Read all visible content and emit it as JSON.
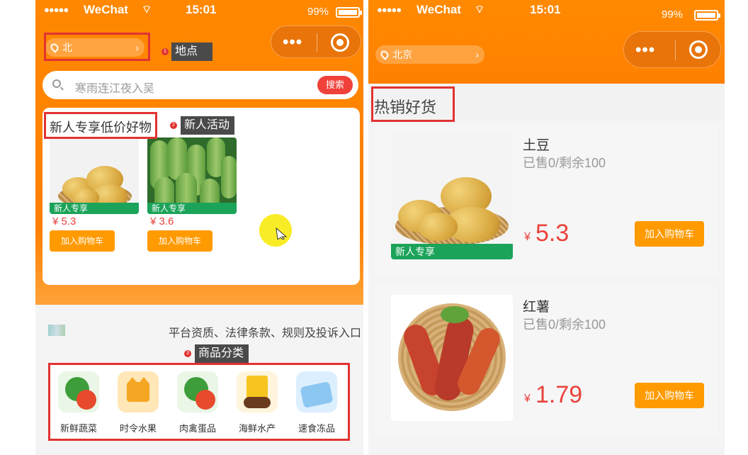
{
  "colors": {
    "brand_orange": "#ff8200",
    "price_red": "#e9433c",
    "newcomer_green": "#1ba35a",
    "annotation_red": "#e23232"
  },
  "left_phone": {
    "status_bar": {
      "carrier": "WeChat",
      "time": "15:01",
      "battery": "99%"
    },
    "location": {
      "text": "北",
      "chevron": "›",
      "icon": "location-pin-icon"
    },
    "annotations": {
      "location": {
        "num": "1",
        "label": "地点"
      },
      "newcomer": {
        "num": "2",
        "label": "新人活动"
      },
      "category": {
        "num": "3",
        "label": "商品分类"
      }
    },
    "search": {
      "placeholder": "寒雨连江夜入吴",
      "button": "搜索"
    },
    "newcomer_section": {
      "title": "新人专享低价好物",
      "products": [
        {
          "tag": "新人专享",
          "price": "¥ 5.3",
          "cart_button": "加入购物车",
          "image": "potato"
        },
        {
          "tag": "新人专享",
          "price": "¥ 3.6",
          "cart_button": "加入购物车",
          "image": "gourd"
        }
      ]
    },
    "info_bar": {
      "text": "平台资质、法律条款、规则及投诉入口"
    },
    "categories": [
      {
        "label": "新鲜蔬菜",
        "icon": "vegetable-icon"
      },
      {
        "label": "时令水果",
        "icon": "crown-icon"
      },
      {
        "label": "肉禽蛋品",
        "icon": "vegetable-icon"
      },
      {
        "label": "海鲜水产",
        "icon": "snack-bag-icon"
      },
      {
        "label": "速食冻品",
        "icon": "frozen-food-icon"
      }
    ]
  },
  "right_phone": {
    "status_bar": {
      "carrier": "WeChat",
      "time": "15:01",
      "battery": "99%"
    },
    "location": {
      "text": "北京",
      "chevron": "›"
    },
    "hot_title": "热销好货",
    "products": [
      {
        "name": "土豆",
        "sales": "已售0/剩余100",
        "currency": "¥",
        "price": "5.3",
        "cart_button": "加入购物车",
        "tag": "新人专享",
        "image": "potato"
      },
      {
        "name": "红薯",
        "sales": "已售0/剩余100",
        "currency": "¥",
        "price": "1.79",
        "cart_button": "加入购物车",
        "image": "sweet-potato"
      }
    ]
  }
}
